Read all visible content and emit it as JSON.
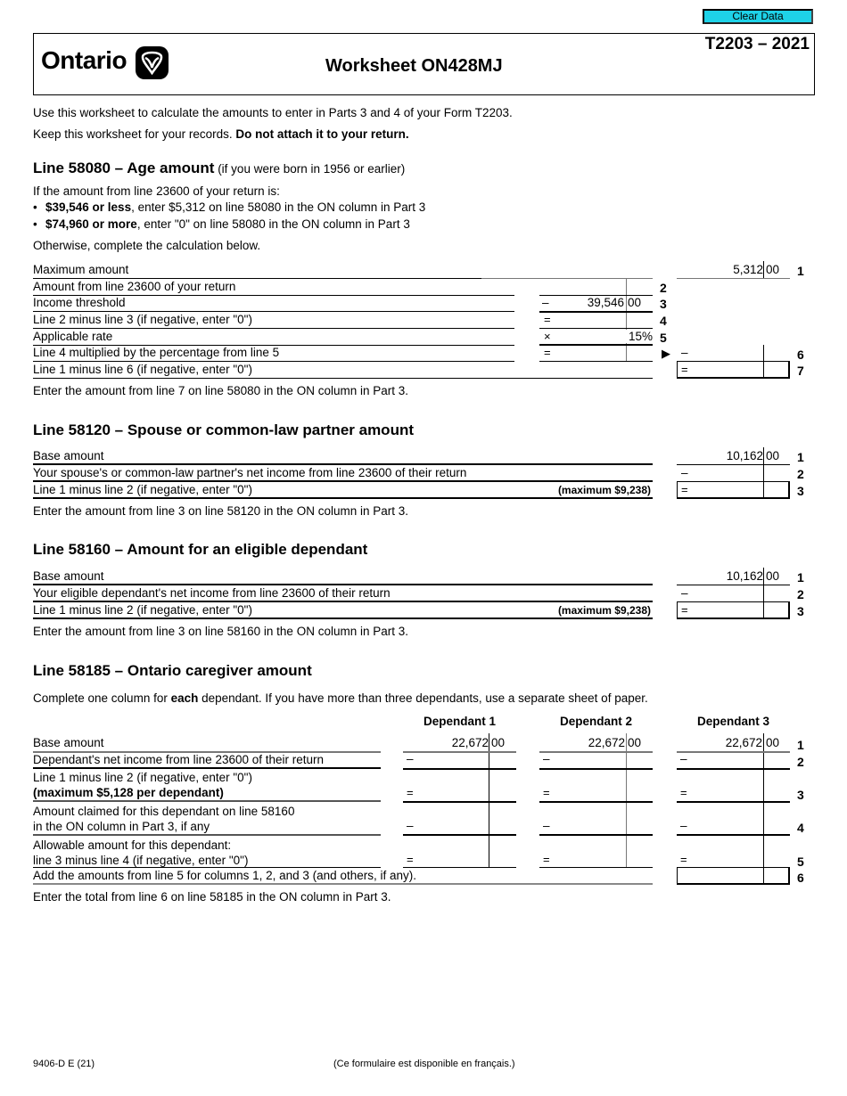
{
  "toolbar": {
    "clear_label": "Clear Data",
    "clear_color": "#1ed2e8"
  },
  "header": {
    "brand": "Ontario",
    "logo_icon": "trillium-icon",
    "title": "Worksheet ON428MJ",
    "form_id": "T2203 – 2021"
  },
  "intro": {
    "line1": "Use this worksheet to calculate the amounts to enter in Parts 3 and 4 of your Form T2203.",
    "line2_normal": "Keep this worksheet for your records. ",
    "line2_bold": "Do not attach it to your return."
  },
  "age": {
    "heading": "Line 58080 – Age amount",
    "heading_sub": " (if you were born in 1956 or earlier)",
    "if_text": "If the amount from line 23600 of your return is:",
    "bullets": [
      {
        "bold": "$39,546 or less",
        "rest": ", enter $5,312 on line 58080 in the ON column in Part 3"
      },
      {
        "bold": "$74,960 or more",
        "rest": ", enter \"0\" on line 58080 in the ON column in Part 3"
      }
    ],
    "otherwise": "Otherwise, complete the calculation below.",
    "rows": [
      {
        "label": "Maximum amount",
        "line": "1",
        "dollars": "5,312",
        "cents": "00"
      },
      {
        "label": "Amount from line 23600 of your return",
        "line": "2"
      },
      {
        "label": "Income threshold",
        "line": "3",
        "op": "–",
        "dollars": "39,546",
        "cents": "00"
      },
      {
        "label": "Line 2 minus line 3 (if negative, enter \"0\")",
        "line": "4",
        "op": "="
      },
      {
        "label": "Applicable rate",
        "line": "5",
        "op": "×",
        "value": "15%"
      },
      {
        "label": "Line 4 multiplied by the percentage from line 5",
        "line": "6",
        "op": "=",
        "op2": "–",
        "arrow": "▶"
      },
      {
        "label": "Line 1 minus line 6 (if negative, enter \"0\")",
        "line": "7",
        "op": "="
      }
    ],
    "note": "Enter the amount from line 7 on line 58080 in the ON column in Part 3."
  },
  "spouse": {
    "heading": "Line 58120 – Spouse or common-law partner amount",
    "rows": [
      {
        "label": "Base amount",
        "line": "1",
        "dollars": "10,162",
        "cents": "00"
      },
      {
        "label": "Your spouse's or common-law partner's net income from line 23600 of their return",
        "line": "2",
        "op": "–"
      },
      {
        "label": "Line 1 minus line 2 (if negative, enter \"0\")",
        "line": "3",
        "op": "=",
        "max": "(maximum $9,238)"
      }
    ],
    "note": "Enter the amount from line 3 on line 58120 in the ON column in Part 3."
  },
  "dependant": {
    "heading": "Line 58160 – Amount for an eligible dependant",
    "rows": [
      {
        "label": "Base amount",
        "line": "1",
        "dollars": "10,162",
        "cents": "00"
      },
      {
        "label": "Your eligible dependant's net income from line 23600 of their return",
        "line": "2",
        "op": "–"
      },
      {
        "label": "Line 1 minus line 2 (if negative, enter \"0\")",
        "line": "3",
        "op": "=",
        "max": "(maximum $9,238)"
      }
    ],
    "note": "Enter the amount from line 3 on line 58160 in the ON column in Part 3."
  },
  "caregiver": {
    "heading": "Line 58185 – Ontario caregiver amount",
    "instr_pre": "Complete one column for ",
    "instr_bold": "each",
    "instr_post": " dependant. If you have more than three dependants, use a separate sheet of paper.",
    "columns": [
      "Dependant 1",
      "Dependant 2",
      "Dependant 3"
    ],
    "rows": [
      {
        "label": "Base amount",
        "line": "1",
        "dollars": "22,672",
        "cents": "00"
      },
      {
        "label": "Dependant's net income from line 23600 of their return",
        "line": "2",
        "op": "–"
      },
      {
        "label": "Line 1 minus line 2 (if negative, enter \"0\")",
        "label_bold": "(maximum $5,128 per dependant)",
        "line": "3",
        "op": "="
      },
      {
        "label": "Amount claimed for this dependant on line 58160",
        "label2": "in the ON column in Part 3, if any",
        "line": "4",
        "op": "–"
      },
      {
        "label": "Allowable amount for this dependant:",
        "label2": "line 3 minus line 4 (if negative, enter \"0\")",
        "line": "5",
        "op": "="
      },
      {
        "label": "Add the amounts from line 5 for columns 1, 2, and 3 (and others, if any).",
        "line": "6"
      }
    ],
    "note": "Enter the total from line 6 on line 58185 in the ON column in Part 3."
  },
  "footer": {
    "form_code": "9406-D E (21)",
    "french": "(Ce formulaire est disponible en français.)"
  }
}
